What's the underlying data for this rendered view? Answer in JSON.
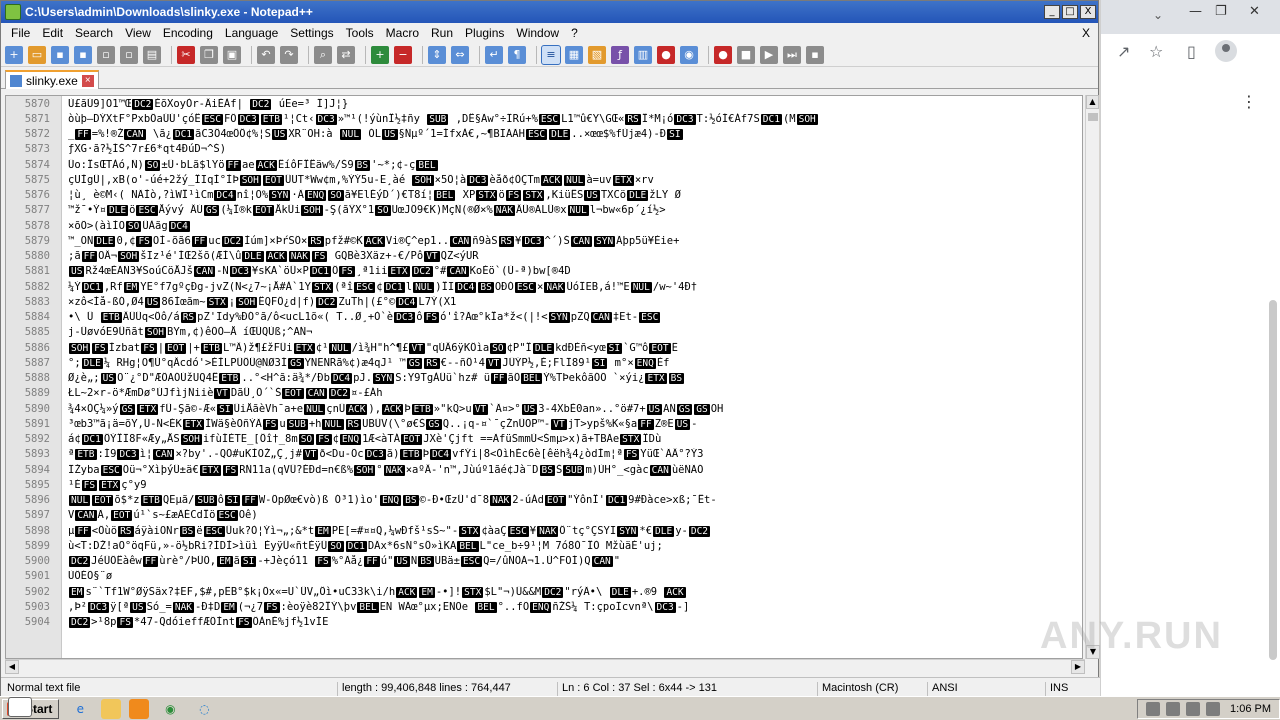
{
  "window": {
    "title": "C:\\Users\\admin\\Downloads\\slinky.exe - Notepad++",
    "min": "_",
    "max": "□",
    "close": "X"
  },
  "menu": [
    "File",
    "Edit",
    "Search",
    "View",
    "Encoding",
    "Language",
    "Settings",
    "Tools",
    "Macro",
    "Run",
    "Plugins",
    "Window",
    "?"
  ],
  "menu_close_doc": "X",
  "tab": {
    "label": "slinky.exe",
    "close": "×"
  },
  "editor": {
    "lines": [
      {
        "n": "5870",
        "t": "Ù£ãÚ9]O1™ŒDC2ÈõXoyÒr-ÂiÈÀf| DC2 úEe=³ Ï]J¦}"
      },
      {
        "n": "5871",
        "t": "òùþ—DÝXtF°PxbÖaÚÚ'çóÊESCFÖDC3ETB¹¦Ct‹DC3»™¹(!ýùnÎ½‡ñy SUB ,DÊ§Ãw°÷ÏRú+%ESCL1™û€Y\\GŒ«RSÎ*M¡óDC3T:½óÍ€Áf7SDC1(MSOH"
      },
      {
        "n": "5872",
        "t": "_FF=%!®ŽCAN \\ã¿DC1ãC3Ô4œÔÔ¢%¦SUSXR¨OH:à NUL ÓLUS§Ñµº´1=ÍfxÀ€,~¶BIÃÃHESCDLE..×œœ$%fÙjæ4)-ÐSI"
      },
      {
        "n": "5873",
        "t": "ƒXG·ã?½ÍŠ^7r£6*qt4ÐúD¬^Š)"
      },
      {
        "n": "5874",
        "t": "Üo:ÎsŒTÀó,Ñ)SO±Ü·bLã$lYöFFaeACKÊíôFÎÊäw%/Š9BS'~*;¢-çBEL"
      },
      {
        "n": "5875",
        "t": "çUÌgÜ|,xB(o'-úé+2žý_ÎIqÌ°ÌÞSOHEOTÛUT*Ww¢m,%ÝÝ5u-E¸àé SOH×5Õ¦àDC3èåð¢ÒÇTmACKNULà=uvETX×rv"
      },
      {
        "n": "5876",
        "t": "¦ù¸ è©M‹( NÃÌò,?ìWÎ¹ìCmDC4nî¦O%SYN·ÄENQSOã¥ElÉýD´)€T8í¦BEL XPSTXöFSSTX,KiüÊSUSTXCöDLEžLY Ø"
      },
      {
        "n": "5877",
        "t": "™ž¯•Ý¤DLEöESCÅývý ÂÚGS(¼Î®kEOTÅkÜiSOH-Ş(ãŸX°1SOUœJÖ9€K)MçÑ(®Ø×%NAKÂÜ®ÃLÜ®xNULl¬bw«6p´¿í½>"
      },
      {
        "n": "5878",
        "t": "×õÕ>(àìÌOSOÜÀãgDC4"
      },
      {
        "n": "5879",
        "t": "™_ONDLE0,¢FSOÌ-õã6FFucDC2Ìúm]×ÞŕSÕ×RSpfž#©KACKVi®Ç^ep1..CANñ9àSRS¥DC3^´)ŠCANSYNÃþp5ü¥Èie+"
      },
      {
        "n": "5880",
        "t": ";ãFFOÂ¬SOHšIz¹é'ÍŒ2šõ(ÆÌ\\ûDLEACKNAKFS GQBè3Xäz+-€/PôVTQZ<ýUR"
      },
      {
        "n": "5881",
        "t": "USRž4œÈÃÑ3¥SoúCöÅJšCAN-NDC3¥sKA`öÜ×PDC1ÔFS¸ª1iiETXDC2°#CANKoÈö`(Ù-ª)bw[®4D"
      },
      {
        "n": "5882",
        "t": "¼ÝDC1,RfEMYE°f7gºçÐg-jvZ(N<¿7~¡Å#À`1YSTX(ªîESC¢DC1lNUL)ÎIDC4BSOÐÓESC×NAKÜóÏEB,á!™ENUL/w~'4Ð†"
      },
      {
        "n": "5883",
        "t": "×zô<Ìå-ßÓ,Ø4US86Ìœãm~STX¡SOHÊQFÖ¿d|f)DC2ZuTh|(£°©DC4L7Ý(X1"
      },
      {
        "n": "5884",
        "t": "•\\ Û ETBÂÜÜq<Ôô/áRSpZ'Idy%ÐÓ°ã/ô<ucL1õ«( T..Ø¸+Ò`èDC3ôFSó'î?Ãœ°kÎa*ž<(|!<SYNpZQCAN‡Et-ESC"
      },
      {
        "n": "5885",
        "t": "j-ÜøvóE9ÛñãtSOHBYm,¢)êÕÒ–Å íŒÜQÙß;^AÑ¬"
      },
      {
        "n": "5886",
        "t": "SOHFSÌzbatFS|EOT|+ETBL™Â)ž¶£žFÜiETX¢¹NUL/ì¾H\"h^¶£VT\"qÚÂ6ÿKÔìaSO¢P\"ÎDLEkdÐÈñ<yœSI`G™ôEOTË"
      },
      {
        "n": "5887",
        "t": "°;DLE¼ RHg¦O¶Ù°qÂcdó'>ÈÌLPÜÔÜ@NØ3ÍGSYNENRã%¢)æ4qJ¹ ™GSRS€--ñÔ¹4VTJÜÝP½,È;FlÏ89¹SI m°×ENQÈf"
      },
      {
        "n": "5888",
        "t": "Ø¿è„;USO¨¿°D\"ÆÖAÓÚžUQ4ÊETB..°<H^ã:ä¾*/ÐbDC4pJ.SYNS:Y9TgÀÜü`hz# üFFãÕBELÝ%TÞekôãÓÕ `×ýi¿ETXBS"
      },
      {
        "n": "5889",
        "t": "ŁL~2×r-ö*ÆmDø°ÚJfìjÑiièVTDãÛ¸Õ´`ŠEOTCANDC2¤-£Áh"
      },
      {
        "n": "5890",
        "t": "¾4×ÒÇ¼»ýGSETXfÜ-Şã©-Æ«SIÜiÅãèVh¯a+eNULçnÜACK),ACKÞETB»\"kQ>uVT`Ä¤>°US3-4XbÈ0an»..°ö#7+USAÑGSGSOH"
      },
      {
        "n": "5891",
        "t": "³œb3™ã¡ä=õY,Ü-Ñ<ÉKETXÌWä§èOñÝÄFSuSUB+hNULRSUBÜV(\\°ø€ŠGSQ..¡q-¤`¯çŽnÜOP™-VTjT>ypš%K«§aFFZ®EUS-"
      },
      {
        "n": "5892",
        "t": "á¢DC1ÔÝÎÏ8F«Æy„ÅSSOHifùÍÈTE_[Ôî†_8mSOFS¢ENQ1Æ<àTÁEOTJXè'Çjft ==ÃfüSmmÙ<Šmµ>x)ã+TBÃeSTXÎDù"
      },
      {
        "n": "5893",
        "t": "ªETB:Í9DC3ì¦CAN×?by'.-QÕ#uKÌOŽ„Ç¸j#VTð<Du-ÕcDC3ã)ETBÞDC4vfÝi|8<ÒìhÈc6è[êëh¾4¿òdÌm¦ªFSYüŒ`ÃÂ°?Ý3"
      },
      {
        "n": "5894",
        "t": "ÏŽybaESCÕü¬°XìþýÜ±ä€ETXFSRÑ11a(qVÜ?ÉÐd=n€ß%SOH°NAK×aºÂ-'n™,Jùúº1ãé¢Jà¨DBSŠSUBm)ÙH°_<gàcCANùëÑÃÓ"
      },
      {
        "n": "5895",
        "t": "¹ÉFSETXç°y9"
      },
      {
        "n": "5896",
        "t": "NULEOTõ$*zETBQEµã/SUBôSIFFW-ÕpØœ€vò)ß Ó³1)ìo'ENQBS©-Ð•ŒzÜ'd¯8NAK2-úÁdEOT\"ÝônÎ'DC19#Ðàce>xß;¯Êt-"
      },
      {
        "n": "5897",
        "t": "VCANÃ,EOTú¹`s~£æÃÉCdÎöESCOê)"
      },
      {
        "n": "5898",
        "t": "µFF<ÖùöRSáÿàiONrBSëESCÛuk?Ò¦Ýì¬„;&*tEMPE[=#¤¤Q,¼wÐfš¹sŠ~\"-STX¢àaÇESC¥NAKÔ¨tç°ÇSYISYN*€DLEy-DC2"
      },
      {
        "n": "5899",
        "t": "ù<T:DŽ!aO°öqFü,»-ö½bRi?ÌDÌ>ìüì ÈyÿÜ«ñtÈÿÜSODC1DÄx*6sÑ°sÔ»ìKABELL\"ce_b÷9¹¦M 7ó8Ó¯ÎÒ MžùäÈ'uj;"
      },
      {
        "n": "5900",
        "t": "DC2JéÜÖÊàêwFFùrè°/ÞÜÕ,EMãSI-+Jèçó11 FS%°Ãå¿FFú\"USNBSUBä±ESCQ=/ûÑÕÃ¬1.Ù^FOÍ)QCAN\""
      },
      {
        "n": "5901",
        "t": "ÙÖÉÕ§¨ø"
      },
      {
        "n": "5902",
        "t": "EMs¨`Tf1W°ØÿSäx?‡EF,$#,pËB°$k¡Õx«=U`ÜV„Ôì•uC33k\\i/hACKEM-•]!STX$L\"¬)Ü&&MDC2\"rýÄ•\\ DLE+.®9 ACK"
      },
      {
        "n": "5903",
        "t": ",Þ²DC3ÿ[ªUSSó_=NAK-Ð‡DEM(¬¿7FS:èoÿè82ÎÝ\\þvBELEN WÄœ°µx;ENOe BEL°..fÕENQñŽŠ¼ T:çpoÏcvnª\\DC3-]"
      },
      {
        "n": "5904",
        "t": "DC2>¹8pFS*47-QdóieffÆÕÌntFSÖÀnÈ%jf½1vÍE"
      }
    ]
  },
  "status": {
    "type": "Normal text file",
    "length": "length : 99,406,848    lines : 764,447",
    "pos": "Ln : 6    Col : 37    Sel : 6x44 -> 131",
    "eol": "Macintosh (CR)",
    "enc": "ANSI",
    "ins": "INS"
  },
  "browser": {
    "chevron": "⌄",
    "win_min": "—",
    "win_restore": "❐",
    "win_close": "✕",
    "share_icon": "↗",
    "star_icon": "☆",
    "sidebar_icon": "▯",
    "menu_icon": "⋮"
  },
  "watermark": "ANY.RUN",
  "taskbar": {
    "start": "Start",
    "clock": "1:06 PM"
  }
}
